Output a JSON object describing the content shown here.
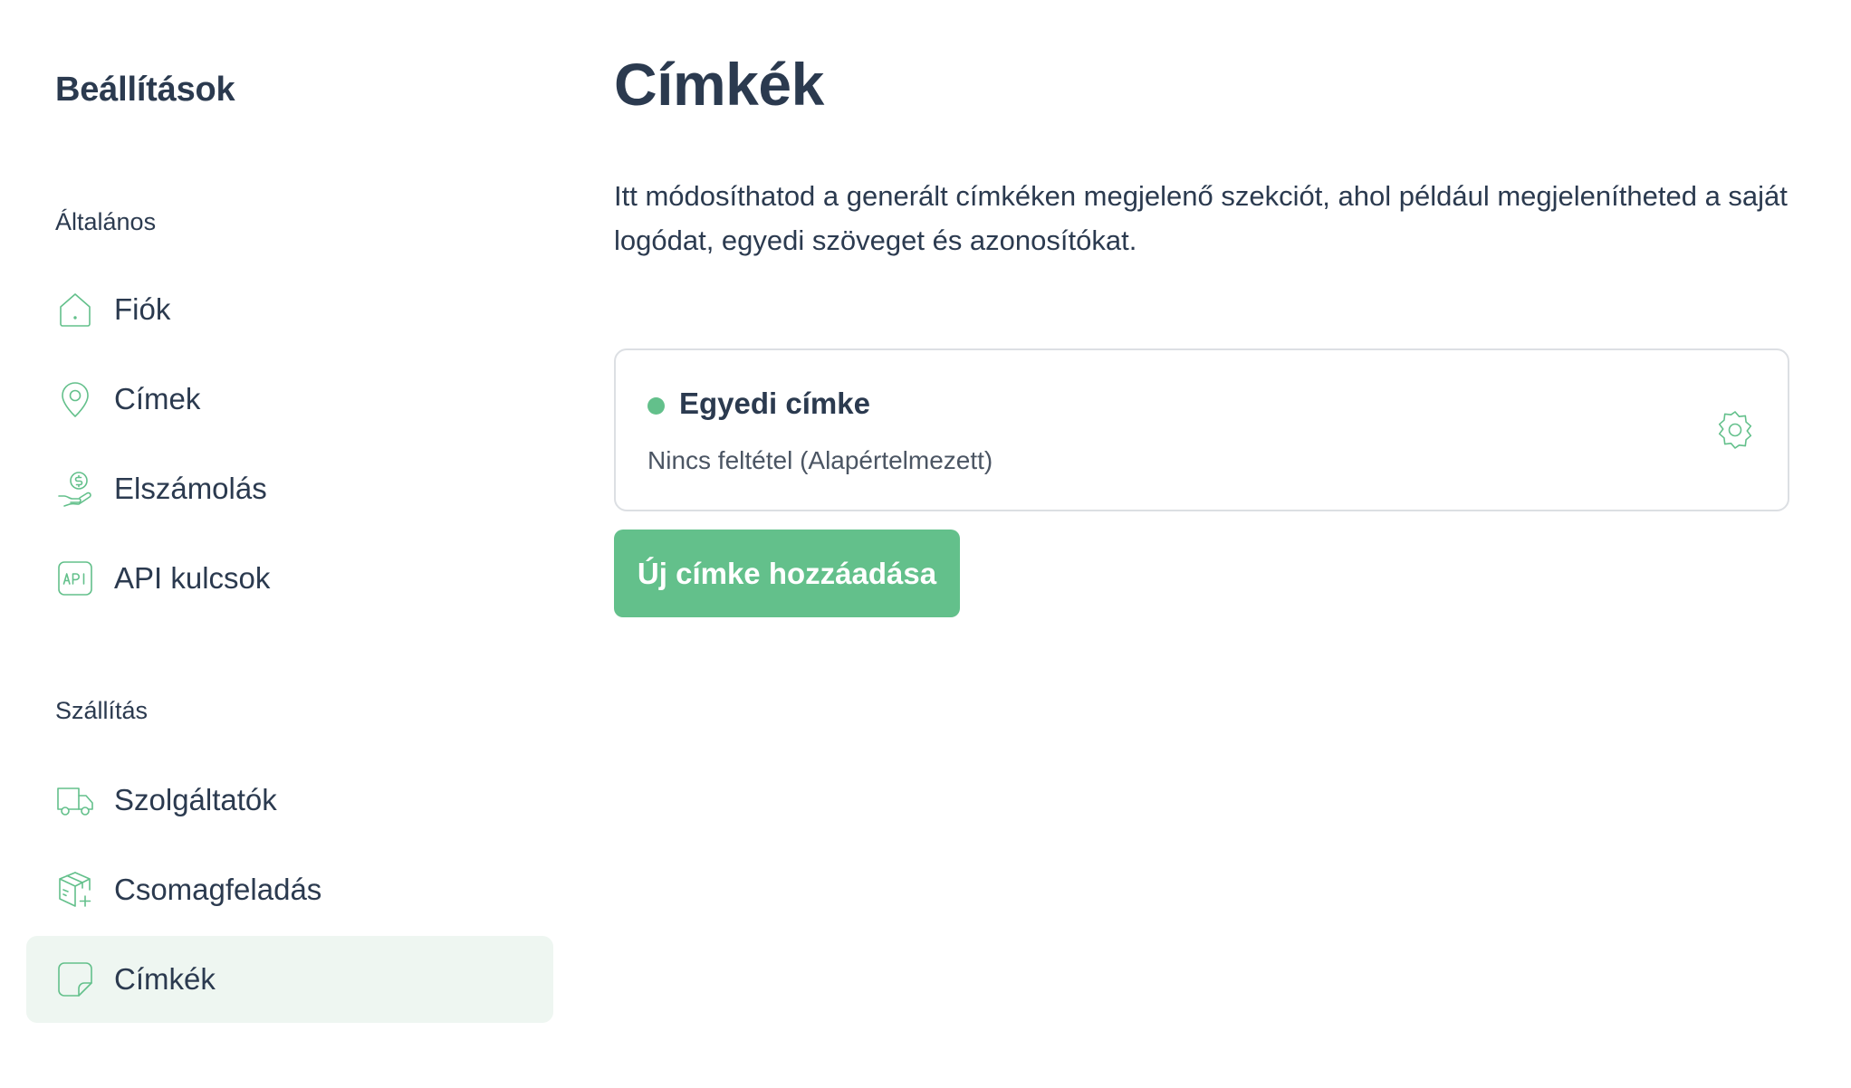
{
  "sidebar": {
    "title": "Beállítások",
    "sections": [
      {
        "label": "Általános",
        "items": [
          {
            "label": "Fiók",
            "icon": "home-icon",
            "active": false
          },
          {
            "label": "Címek",
            "icon": "map-pin-icon",
            "active": false
          },
          {
            "label": "Elszámolás",
            "icon": "hand-dollar-icon",
            "active": false
          },
          {
            "label": "API kulcsok",
            "icon": "api-icon",
            "active": false
          }
        ]
      },
      {
        "label": "Szállítás",
        "items": [
          {
            "label": "Szolgáltatók",
            "icon": "truck-icon",
            "active": false
          },
          {
            "label": "Csomagfeladás",
            "icon": "package-plus-icon",
            "active": false
          },
          {
            "label": "Címkék",
            "icon": "sticky-note-icon",
            "active": true
          }
        ]
      }
    ]
  },
  "main": {
    "title": "Címkék",
    "description": "Itt módosíthatod a generált címkéken megjelenő szekciót, ahol például megjelenítheted a saját logódat, egyedi szöveget és azonosítókat.",
    "labels": [
      {
        "name": "Egyedi címke",
        "condition": "Nincs feltétel (Alapértelmezett)",
        "status_color": "#63c08b"
      }
    ],
    "add_button_label": "Új címke hozzáadása"
  },
  "colors": {
    "accent": "#63c08b",
    "active_bg": "#eef6f1",
    "text": "#2b3a4f",
    "border": "#dcdfe3"
  }
}
